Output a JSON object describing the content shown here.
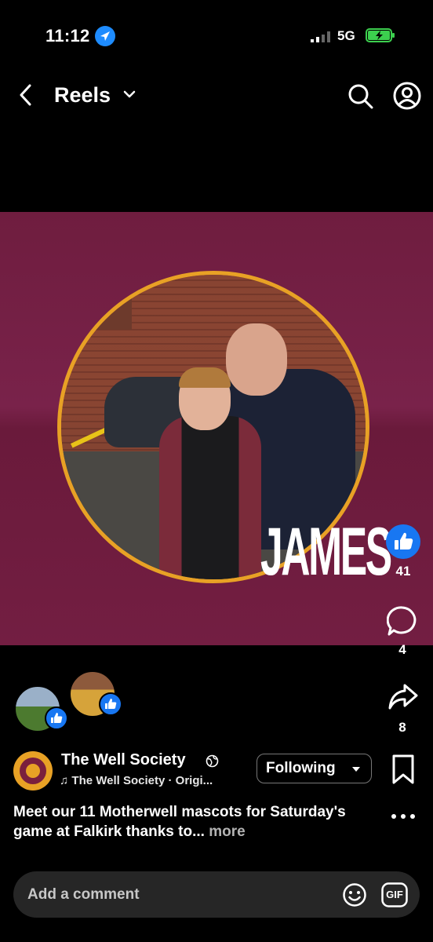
{
  "status_bar": {
    "time": "11:12",
    "network": "5G"
  },
  "header": {
    "title": "Reels"
  },
  "video": {
    "overlay_name": "JAMES"
  },
  "actions": {
    "likes": "41",
    "comments": "4",
    "shares": "8"
  },
  "post": {
    "author": "The Well Society",
    "audio": "The Well Society · Origi...",
    "follow_label": "Following",
    "caption": "Meet our 11 Motherwell mascots for Saturday's game at Falkirk thanks to...",
    "more_label": "more"
  },
  "comment_bar": {
    "placeholder": "Add a comment",
    "gif_label": "GIF"
  },
  "colors": {
    "like_blue": "#1877f2",
    "video_bg": "#731e42",
    "ring": "#e8a125"
  }
}
